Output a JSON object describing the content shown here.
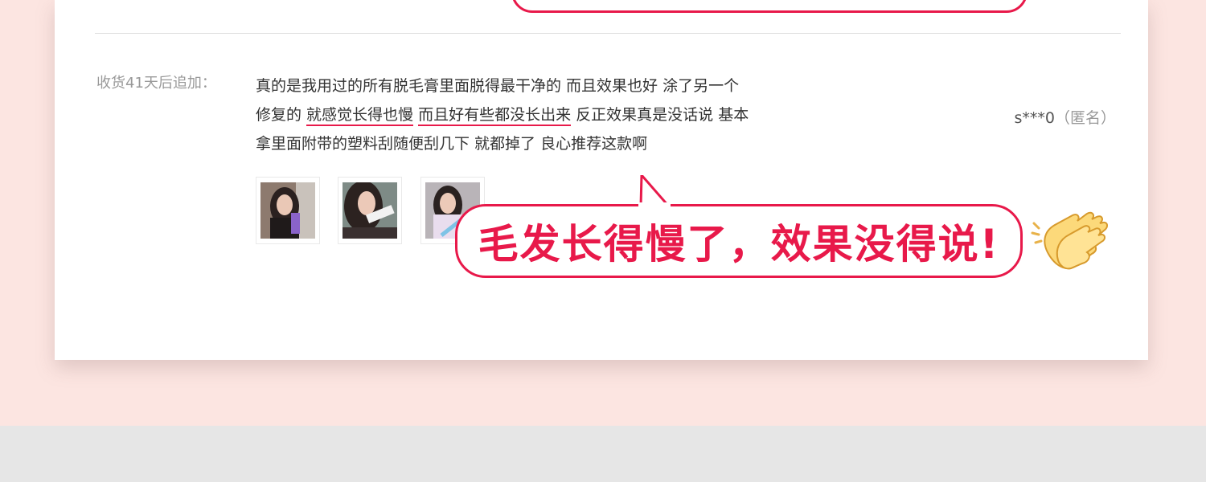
{
  "review": {
    "label": "收货41天后追加：",
    "line1": "真的是我用过的所有脱毛膏里面脱得最干净的 而且效果也好 涂了另一个",
    "line2_pre": "修复的 ",
    "line2_u1": "就感觉长得也慢",
    "line2_gap": " ",
    "line2_u2": "而且好有些都没长出来",
    "line2_post": " 反正效果真是没话说 基本",
    "line3": "拿里面附带的塑料刮随便刮几下 就都掉了 良心推荐这款啊",
    "username": "s***0",
    "anonymous": "（匿名）"
  },
  "callout": {
    "text": "毛发长得慢了，效果没得说!",
    "color": "#e8194a"
  },
  "icons": {
    "clap": "clapping-hands-icon"
  }
}
